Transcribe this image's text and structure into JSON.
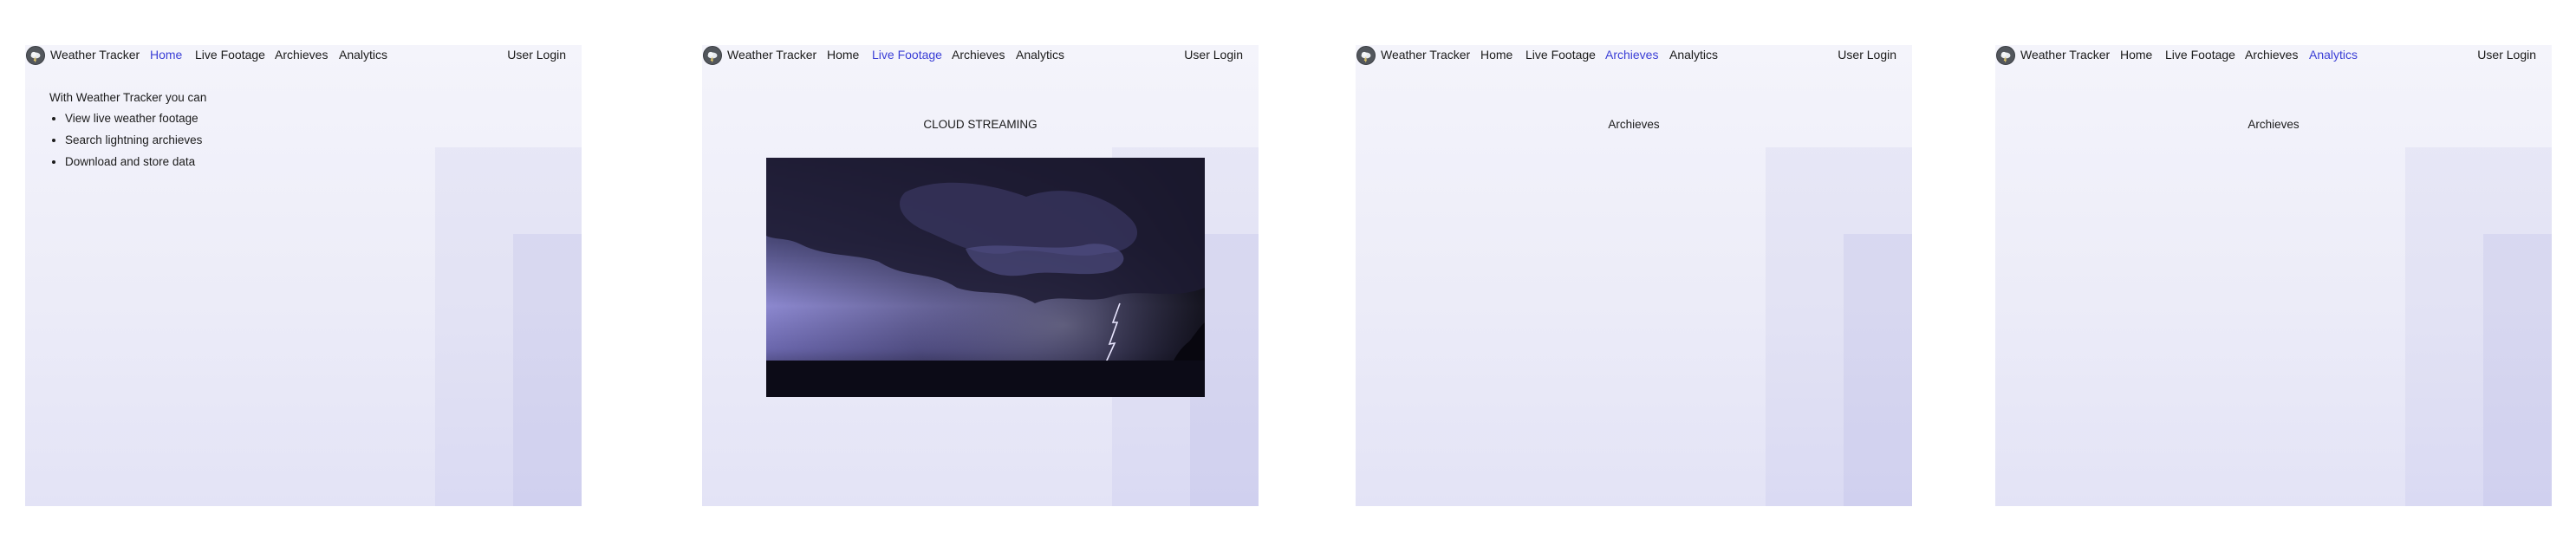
{
  "app": {
    "brand": "Weather Tracker",
    "user_login": "User Login",
    "nav": [
      "Home",
      "Live Footage",
      "Archieves",
      "Analytics"
    ],
    "accent_color": "#3b3fd6",
    "logo_icon": "cloud-storm-icon"
  },
  "screens": [
    {
      "active_tab": "Home",
      "intro": "With Weather Tracker you can",
      "features": [
        "View live weather footage",
        "Search lightning archieves",
        "Download and store data"
      ]
    },
    {
      "active_tab": "Live Footage",
      "title": "CLOUD STREAMING",
      "media": "lightning-storm-video"
    },
    {
      "active_tab": "Archieves",
      "title": "Archieves"
    },
    {
      "active_tab": "Analytics",
      "title": "Archieves"
    }
  ]
}
